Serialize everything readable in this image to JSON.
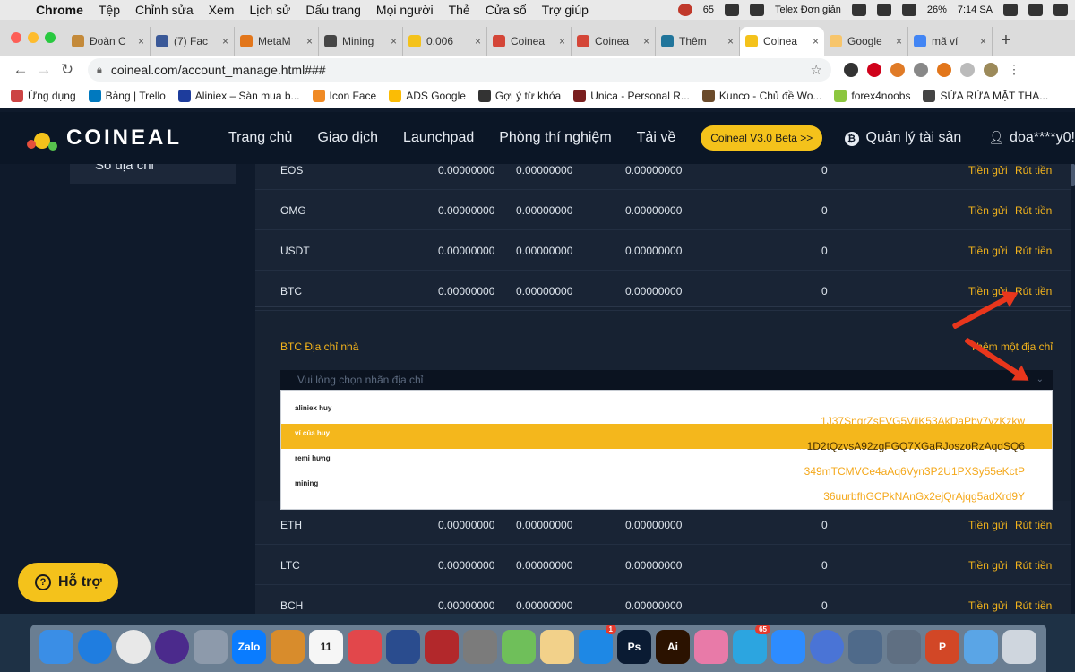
{
  "menubar": {
    "app_name": "Chrome",
    "items": [
      "Tệp",
      "Chỉnh sửa",
      "Xem",
      "Lịch sử",
      "Dấu trang",
      "Mọi người",
      "Thẻ",
      "Cửa sổ",
      "Trợ giúp"
    ],
    "badge_count": "65",
    "input_method": "Telex Đơn giản",
    "battery": "26%",
    "time": "7:14 SA"
  },
  "tabs": [
    {
      "title": "Đoàn C",
      "color": "#c48a3a"
    },
    {
      "title": "(7) Fac",
      "color": "#3b5998"
    },
    {
      "title": "MetaM",
      "color": "#e2761b"
    },
    {
      "title": "Mining",
      "color": "#464646"
    },
    {
      "title": "0.006",
      "color": "#f4c21b"
    },
    {
      "title": "Coinea",
      "color": "#d44638"
    },
    {
      "title": "Coinea",
      "color": "#d44638"
    },
    {
      "title": "Thêm",
      "color": "#21759b"
    },
    {
      "title": "Coinea",
      "color": "#f4c21b",
      "active": true
    },
    {
      "title": "Google",
      "color": "#f7c56b"
    },
    {
      "title": "mã ví",
      "color": "#4285f4"
    }
  ],
  "address_bar": {
    "url": "coineal.com/account_manage.html###"
  },
  "bookmarks": [
    {
      "label": "Ứng dụng",
      "color": "#c44"
    },
    {
      "label": "Bảng | Trello",
      "color": "#0079bf"
    },
    {
      "label": "Aliniex – Sàn mua b...",
      "color": "#1d3c9c"
    },
    {
      "label": "Icon Face",
      "color": "#f08a24"
    },
    {
      "label": "ADS Google",
      "color": "#fbbc05"
    },
    {
      "label": "Gợi ý từ khóa",
      "color": "#333"
    },
    {
      "label": "Unica - Personal R...",
      "color": "#7a1f1f"
    },
    {
      "label": "Kunco - Chủ đề Wo...",
      "color": "#6b4b2b"
    },
    {
      "label": "forex4noobs",
      "color": "#8cc63f"
    },
    {
      "label": "SỬA RỬA MẶT THA...",
      "color": "#444"
    }
  ],
  "site": {
    "logo": "COINEAL",
    "nav": [
      "Trang chủ",
      "Giao dịch",
      "Launchpad",
      "Phòng thí nghiệm",
      "Tải về"
    ],
    "beta_button": "Coineal V3.0 Beta >>",
    "asset_management": "Quản lý tài sản",
    "username": "doa****y0!",
    "left_menu_item": "Sổ địa chỉ",
    "support_button": "Hỗ trợ"
  },
  "actions": {
    "deposit": "Tiền gửi",
    "withdraw": "Rút tiền"
  },
  "rows_top": [
    {
      "coin": "EOS",
      "v1": "0.00000000",
      "v2": "0.00000000",
      "v3": "0.00000000",
      "v4": "0"
    },
    {
      "coin": "OMG",
      "v1": "0.00000000",
      "v2": "0.00000000",
      "v3": "0.00000000",
      "v4": "0"
    },
    {
      "coin": "USDT",
      "v1": "0.00000000",
      "v2": "0.00000000",
      "v3": "0.00000000",
      "v4": "0"
    },
    {
      "coin": "BTC",
      "v1": "0.00000000",
      "v2": "0.00000000",
      "v3": "0.00000000",
      "v4": "0"
    }
  ],
  "btc_panel": {
    "address_label": "BTC Địa chỉ nhà",
    "add_address": "Thêm một địa chỉ",
    "select_placeholder": "Vui lòng chọn nhãn địa chỉ",
    "options": [
      {
        "name": "aliniex huy",
        "address": "1J37SnqrZsFVG5ViiK53AkDaPbv7yzKzkw",
        "selected": false
      },
      {
        "name": "ví của huy",
        "address": "1D2tQzvsA92zgFGQ7XGaRJoszoRzAqdSQ6",
        "selected": true
      },
      {
        "name": "remi hưng",
        "address": "349mTCMVCe4aAq6Vyn3P2U1PXSy55eKctP",
        "selected": false
      },
      {
        "name": "mining",
        "address": "36uurbfhGCPkNAnGx2ejQrAjqg5adXrd9Y",
        "selected": false
      }
    ]
  },
  "rows_bottom": [
    {
      "coin": "ETH",
      "v1": "0.00000000",
      "v2": "0.00000000",
      "v3": "0.00000000",
      "v4": "0"
    },
    {
      "coin": "LTC",
      "v1": "0.00000000",
      "v2": "0.00000000",
      "v3": "0.00000000",
      "v4": "0"
    },
    {
      "coin": "BCH",
      "v1": "0.00000000",
      "v2": "0.00000000",
      "v3": "0.00000000",
      "v4": "0"
    }
  ],
  "dock": [
    {
      "name": "finder",
      "color": "#3a8ee6"
    },
    {
      "name": "safari",
      "color": "#1f7de0"
    },
    {
      "name": "chrome",
      "color": "#e8e8e8"
    },
    {
      "name": "siri",
      "color": "#4b2a8c"
    },
    {
      "name": "launchpad",
      "color": "#8d9aab"
    },
    {
      "name": "zalo",
      "color": "#0a7cff",
      "label": "Zalo"
    },
    {
      "name": "notes",
      "color": "#d88c2c"
    },
    {
      "name": "calendar",
      "color": "#f6f6f6",
      "label": "11"
    },
    {
      "name": "messenger-like",
      "color": "#e2474b"
    },
    {
      "name": "screenshot",
      "color": "#2a4c8e"
    },
    {
      "name": "photo-booth",
      "color": "#b2282b"
    },
    {
      "name": "system-preferences",
      "color": "#7b7b7b"
    },
    {
      "name": "maps",
      "color": "#6fbf5a"
    },
    {
      "name": "preview",
      "color": "#f2d18a"
    },
    {
      "name": "app-store",
      "color": "#1e88e5",
      "badge": "1"
    },
    {
      "name": "photoshop",
      "color": "#0a1b33",
      "label": "Ps"
    },
    {
      "name": "illustrator",
      "color": "#2b1200",
      "label": "Ai"
    },
    {
      "name": "folder-pink",
      "color": "#e87aa8"
    },
    {
      "name": "telegram",
      "color": "#2ca5e0",
      "badge": "65"
    },
    {
      "name": "zoom",
      "color": "#2d8cff"
    },
    {
      "name": "atom",
      "color": "#4a74d6"
    },
    {
      "name": "image-capture",
      "color": "#4f6a8a"
    },
    {
      "name": "quicktime",
      "color": "#5f6f82"
    },
    {
      "name": "powerpoint",
      "color": "#d24726",
      "label": "P"
    },
    {
      "name": "downloads-folder",
      "color": "#5aa5e6"
    },
    {
      "name": "trash",
      "color": "#cfd6de"
    }
  ]
}
